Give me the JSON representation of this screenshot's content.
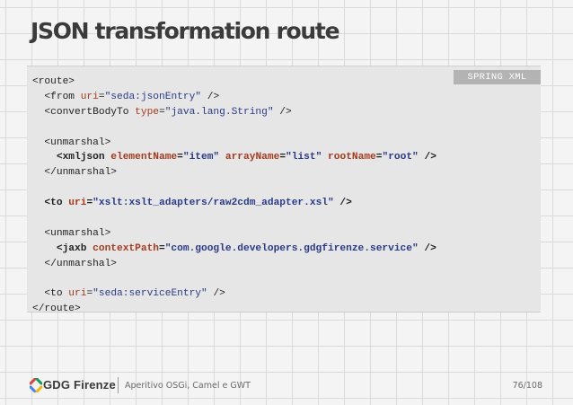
{
  "slide": {
    "title": "JSON transformation route",
    "language_tag": "SPRING XML"
  },
  "code_lines": [
    {
      "bold": false,
      "parts": [
        {
          "c": "tg",
          "t": "<route>"
        }
      ]
    },
    {
      "bold": false,
      "parts": [
        {
          "c": "tg",
          "t": "  <from "
        },
        {
          "c": "at",
          "t": "uri"
        },
        {
          "c": "pl",
          "t": "="
        },
        {
          "c": "st",
          "t": "\"seda:jsonEntry\""
        },
        {
          "c": "tg",
          "t": " />"
        }
      ]
    },
    {
      "bold": false,
      "parts": [
        {
          "c": "tg",
          "t": "  <convertBodyTo "
        },
        {
          "c": "at",
          "t": "type"
        },
        {
          "c": "pl",
          "t": "="
        },
        {
          "c": "st",
          "t": "\"java.lang.String\""
        },
        {
          "c": "tg",
          "t": " />"
        }
      ]
    },
    {
      "bold": false,
      "parts": []
    },
    {
      "bold": false,
      "parts": [
        {
          "c": "tg",
          "t": "  <unmarshal>"
        }
      ]
    },
    {
      "bold": true,
      "parts": [
        {
          "c": "tg",
          "t": "    <xmljson "
        },
        {
          "c": "at",
          "t": "elementName"
        },
        {
          "c": "pl",
          "t": "="
        },
        {
          "c": "st",
          "t": "\"item\""
        },
        {
          "c": "pl",
          "t": " "
        },
        {
          "c": "at",
          "t": "arrayName"
        },
        {
          "c": "pl",
          "t": "="
        },
        {
          "c": "st",
          "t": "\"list\""
        },
        {
          "c": "pl",
          "t": " "
        },
        {
          "c": "at",
          "t": "rootName"
        },
        {
          "c": "pl",
          "t": "="
        },
        {
          "c": "st",
          "t": "\"root\""
        },
        {
          "c": "tg",
          "t": " />"
        }
      ]
    },
    {
      "bold": false,
      "parts": [
        {
          "c": "tg",
          "t": "  </unmarshal>"
        }
      ]
    },
    {
      "bold": false,
      "parts": []
    },
    {
      "bold": true,
      "parts": [
        {
          "c": "tg",
          "t": "  <to "
        },
        {
          "c": "at",
          "t": "uri"
        },
        {
          "c": "pl",
          "t": "="
        },
        {
          "c": "st",
          "t": "\"xslt:xslt_adapters/raw2cdm_adapter.xsl\""
        },
        {
          "c": "tg",
          "t": " />"
        }
      ]
    },
    {
      "bold": false,
      "parts": []
    },
    {
      "bold": false,
      "parts": [
        {
          "c": "tg",
          "t": "  <unmarshal>"
        }
      ]
    },
    {
      "bold": true,
      "parts": [
        {
          "c": "tg",
          "t": "    <jaxb "
        },
        {
          "c": "at",
          "t": "contextPath"
        },
        {
          "c": "pl",
          "t": "="
        },
        {
          "c": "st",
          "t": "\"com.google.developers.gdgfirenze.service\""
        },
        {
          "c": "tg",
          "t": " />"
        }
      ]
    },
    {
      "bold": false,
      "parts": [
        {
          "c": "tg",
          "t": "  </unmarshal>"
        }
      ]
    },
    {
      "bold": false,
      "parts": []
    },
    {
      "bold": false,
      "parts": [
        {
          "c": "tg",
          "t": "  <to "
        },
        {
          "c": "at",
          "t": "uri"
        },
        {
          "c": "pl",
          "t": "="
        },
        {
          "c": "st",
          "t": "\"seda:serviceEntry\""
        },
        {
          "c": "tg",
          "t": " />"
        }
      ]
    },
    {
      "bold": false,
      "parts": [
        {
          "c": "tg",
          "t": "</route>"
        }
      ]
    }
  ],
  "footer": {
    "logo_text": "GDG Firenze",
    "presentation_title": "Aperitivo OSGi, Camel e GWT",
    "page_number": "76/108"
  },
  "colors": {
    "code_tag": "#222222",
    "code_attribute": "#a63a1e",
    "code_string": "#2a3a88",
    "logo_blue": "#4285f4",
    "logo_red": "#db4437",
    "logo_green": "#0f9d58",
    "logo_yellow": "#f4b400"
  }
}
